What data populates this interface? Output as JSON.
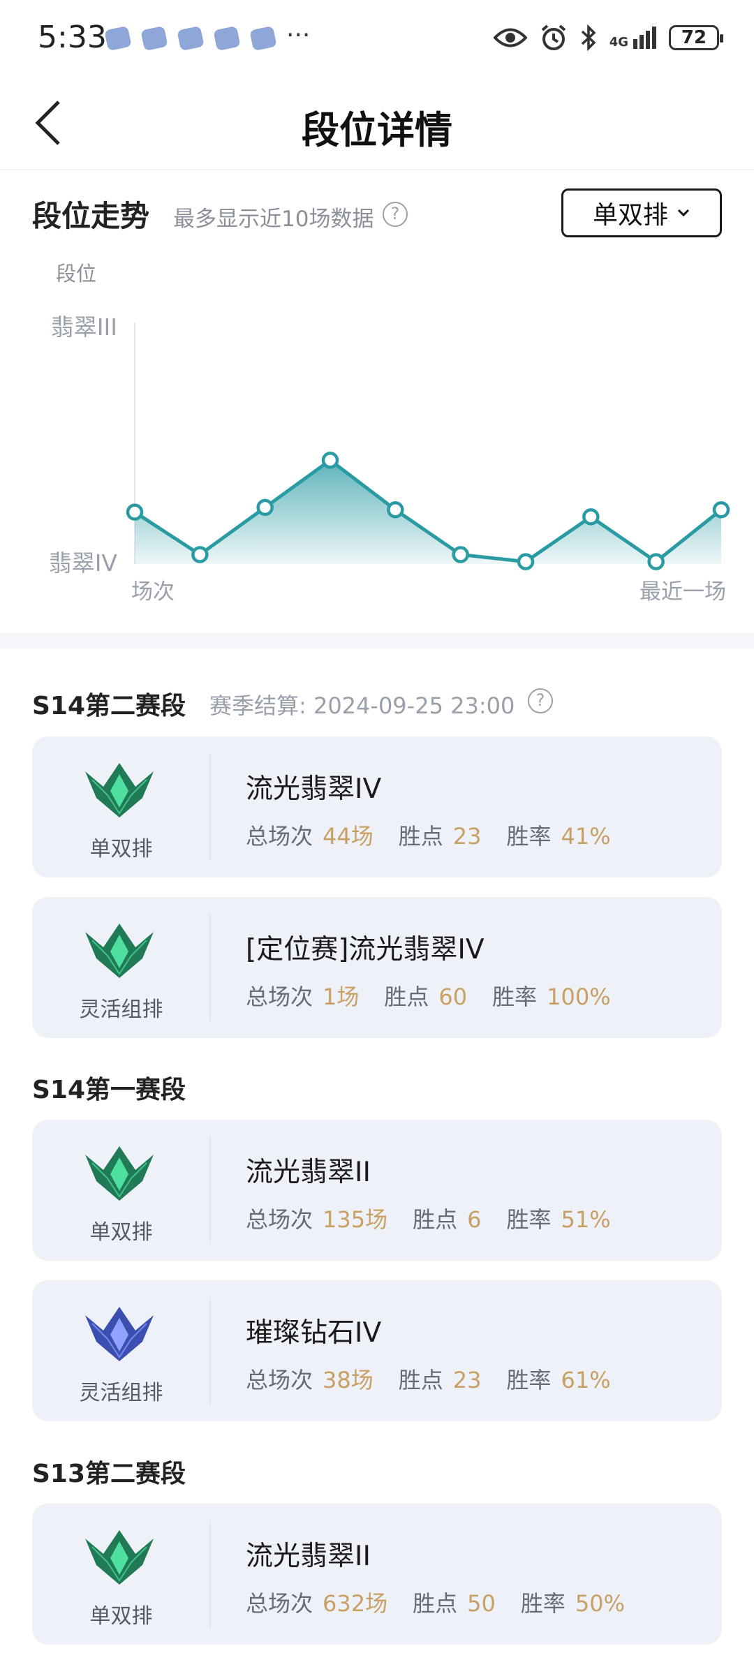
{
  "status_bar": {
    "time": "5:33",
    "more": "···",
    "network": "4G",
    "battery": "72"
  },
  "header": {
    "title": "段位详情"
  },
  "trend": {
    "title": "段位走势",
    "subtitle": "最多显示近10场数据",
    "mode_select": "单双排",
    "help": "?"
  },
  "chart_data": {
    "type": "area",
    "ylabel": "段位",
    "y_ticks": [
      "翡翠III",
      "翡翠IV"
    ],
    "x_start_label": "场次",
    "x_end_label": "最近一场",
    "line_color": "#2a9ba3",
    "values": [
      0.22,
      0.04,
      0.24,
      0.44,
      0.23,
      0.04,
      0.01,
      0.2,
      0.01,
      0.23
    ],
    "ylim": [
      0,
      1
    ]
  },
  "seasons": [
    {
      "title": "S14第二赛段",
      "note": "赛季结算: 2024-09-25 23:00",
      "records": [
        {
          "mode": "单双排",
          "rank": "流光翡翠IV",
          "games_label": "总场次",
          "games": "44场",
          "points_label": "胜点",
          "points": "23",
          "winrate_label": "胜率",
          "winrate": "41%",
          "badge": "emerald-badge"
        },
        {
          "mode": "灵活组排",
          "rank": "[定位赛]流光翡翠IV",
          "games_label": "总场次",
          "games": "1场",
          "points_label": "胜点",
          "points": "60",
          "winrate_label": "胜率",
          "winrate": "100%",
          "badge": "emerald-badge"
        }
      ]
    },
    {
      "title": "S14第一赛段",
      "records": [
        {
          "mode": "单双排",
          "rank": "流光翡翠II",
          "games_label": "总场次",
          "games": "135场",
          "points_label": "胜点",
          "points": "6",
          "winrate_label": "胜率",
          "winrate": "51%",
          "badge": "emerald-badge"
        },
        {
          "mode": "灵活组排",
          "rank": "璀璨钻石IV",
          "games_label": "总场次",
          "games": "38场",
          "points_label": "胜点",
          "points": "23",
          "winrate_label": "胜率",
          "winrate": "61%",
          "badge": "diamond-badge"
        }
      ]
    },
    {
      "title": "S13第二赛段",
      "records": [
        {
          "mode": "单双排",
          "rank": "流光翡翠II",
          "games_label": "总场次",
          "games": "632场",
          "points_label": "胜点",
          "points": "50",
          "winrate_label": "胜率",
          "winrate": "50%",
          "badge": "emerald-badge"
        }
      ]
    }
  ],
  "colors": {
    "accent_gold": "#c9a064",
    "card_bg": "#eef2f8",
    "emerald": "#1f7a55",
    "diamond": "#3a4fb0"
  }
}
